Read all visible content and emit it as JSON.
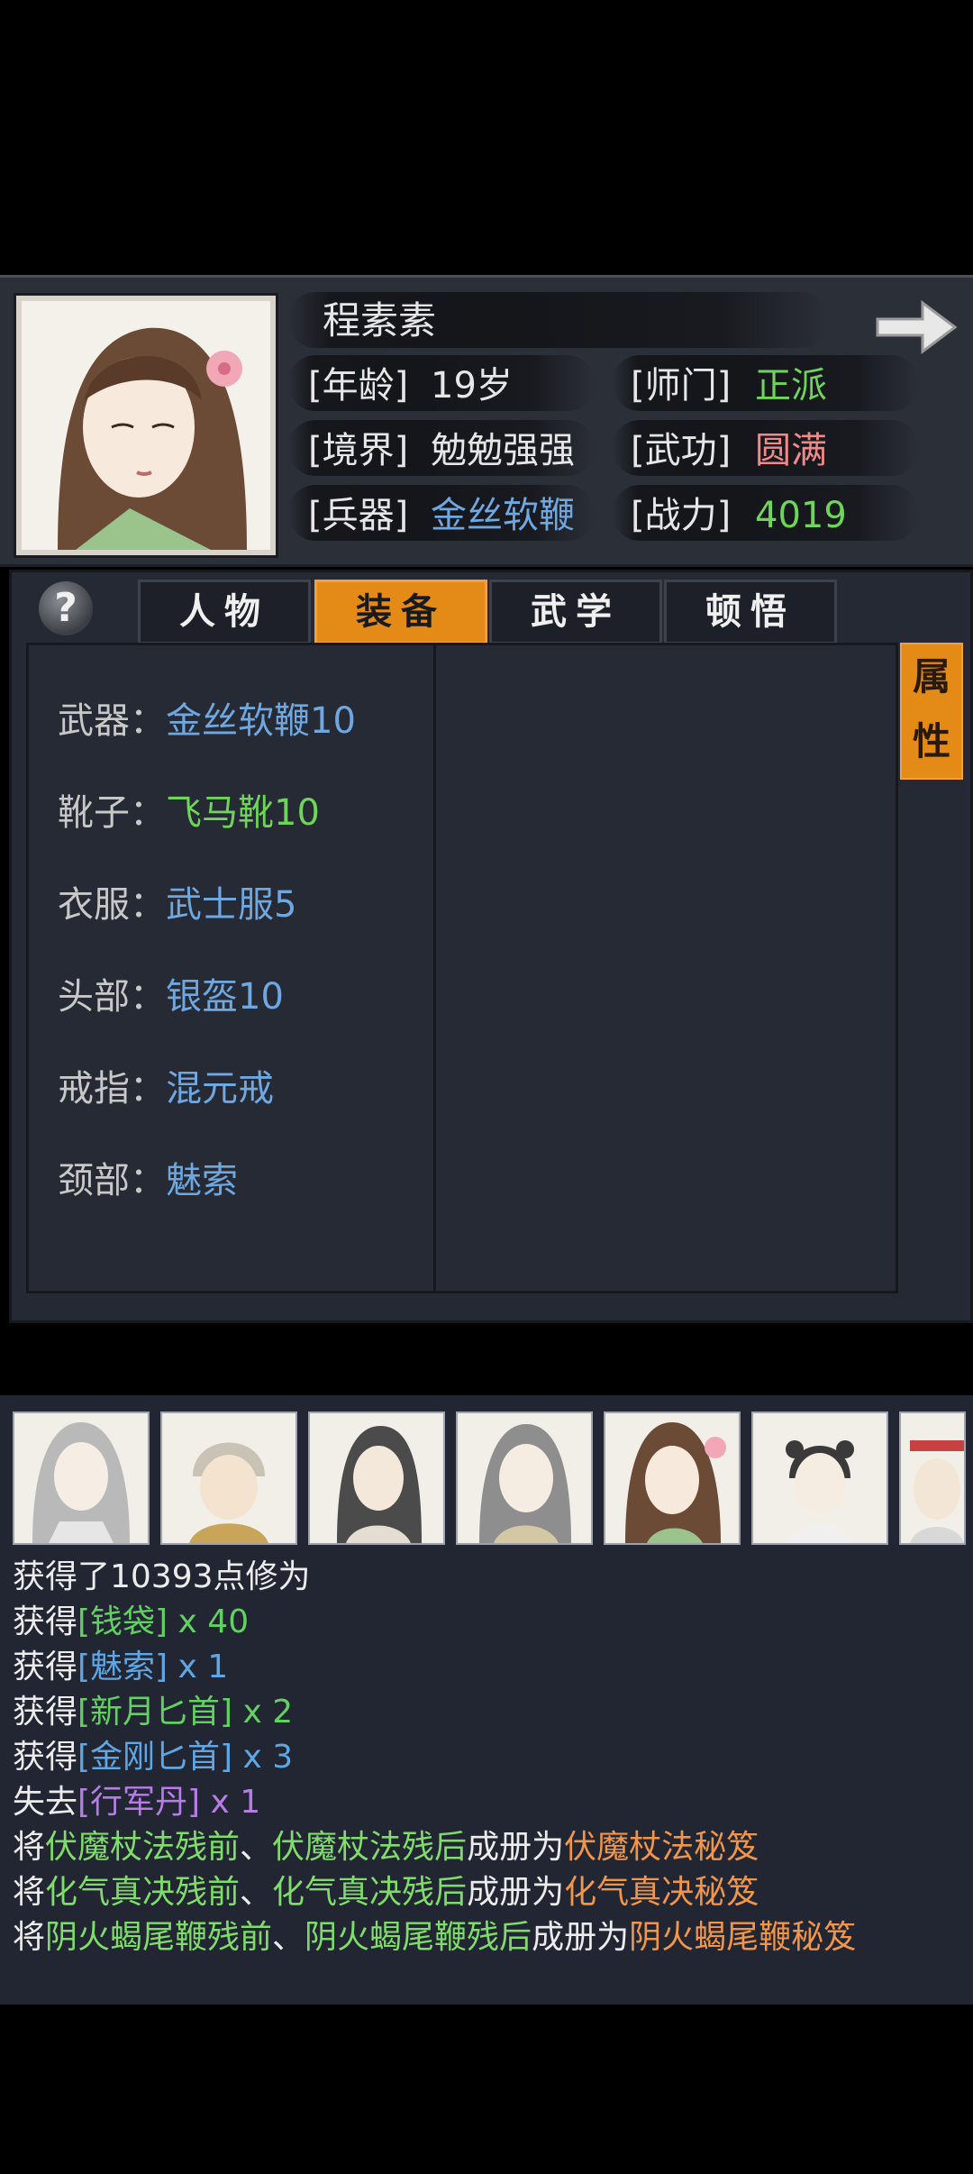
{
  "character": {
    "name": "程素素",
    "rows": [
      {
        "left_label": "[年龄]",
        "left_value": "19岁",
        "right_label": "[师门]",
        "right_value": "正派"
      },
      {
        "left_label": "[境界]",
        "left_value": "勉勉强强",
        "right_label": "[武功]",
        "right_value": "圆满"
      },
      {
        "left_label": "[兵器]",
        "left_value": "金丝软鞭",
        "right_label": "[战力]",
        "right_value": "4019"
      }
    ]
  },
  "tabs": [
    {
      "label": "人物"
    },
    {
      "label": "装备"
    },
    {
      "label": "武学"
    },
    {
      "label": "顿悟"
    }
  ],
  "active_tab": "装备",
  "help_label": "?",
  "attr_button": {
    "line1": "属",
    "line2": "性"
  },
  "equipment": [
    {
      "slot": "武器：",
      "item": "金丝软鞭10",
      "color": "#6fa7e0"
    },
    {
      "slot": "靴子：",
      "item": "飞马靴10",
      "color": "#6fa7e0"
    },
    {
      "slot": "衣服：",
      "item": "武士服5",
      "color": "#6ed45a"
    },
    {
      "slot": "头部：",
      "item": "银盔10",
      "color": "#6fa7e0"
    },
    {
      "slot": "戒指：",
      "item": "混元戒",
      "color": "#6fa7e0"
    },
    {
      "slot": "颈部：",
      "item": "魅索",
      "color": "#6fa7e0"
    }
  ],
  "log": {
    "lines": [
      [
        {
          "t": "获得了10393点修为",
          "c": "white"
        }
      ],
      [
        {
          "t": "获得",
          "c": "white"
        },
        {
          "t": "[钱袋]",
          "c": "green"
        },
        {
          "t": " x 40",
          "c": "green"
        }
      ],
      [
        {
          "t": "获得",
          "c": "white"
        },
        {
          "t": "[魅索]",
          "c": "blue"
        },
        {
          "t": " x 1",
          "c": "blue"
        }
      ],
      [
        {
          "t": "获得",
          "c": "white"
        },
        {
          "t": "[新月匕首]",
          "c": "green"
        },
        {
          "t": " x 2",
          "c": "green"
        }
      ],
      [
        {
          "t": "获得",
          "c": "white"
        },
        {
          "t": "[金刚匕首]",
          "c": "blue"
        },
        {
          "t": " x 3",
          "c": "blue"
        }
      ],
      [
        {
          "t": "失去",
          "c": "white"
        },
        {
          "t": "[行军丹]",
          "c": "purple"
        },
        {
          "t": " x 1",
          "c": "purple"
        }
      ],
      [
        {
          "t": "将",
          "c": "white"
        },
        {
          "t": "伏魔杖法残前",
          "c": "lgreen"
        },
        {
          "t": "、",
          "c": "white"
        },
        {
          "t": "伏魔杖法残后",
          "c": "lgreen"
        },
        {
          "t": "成册为",
          "c": "white"
        },
        {
          "t": "伏魔杖法秘笈",
          "c": "orange"
        }
      ],
      [
        {
          "t": "将",
          "c": "white"
        },
        {
          "t": "化气真决残前",
          "c": "lgreen"
        },
        {
          "t": "、",
          "c": "white"
        },
        {
          "t": "化气真决残后",
          "c": "lgreen"
        },
        {
          "t": "成册为",
          "c": "white"
        },
        {
          "t": "化气真决秘笈",
          "c": "orange"
        }
      ],
      [
        {
          "t": "将",
          "c": "white"
        },
        {
          "t": "阴火蝎尾鞭残前",
          "c": "lgreen"
        },
        {
          "t": "、",
          "c": "white"
        },
        {
          "t": "阴火蝎尾鞭残后",
          "c": "lgreen"
        },
        {
          "t": "成册为",
          "c": "white"
        },
        {
          "t": "阴火蝎尾鞭秘笈",
          "c": "orange"
        }
      ]
    ]
  },
  "colors": {
    "accent_orange": "#e48a16",
    "panel_bg": "#252933",
    "item_blue": "#6fa7e0",
    "item_green": "#6ed45a"
  }
}
